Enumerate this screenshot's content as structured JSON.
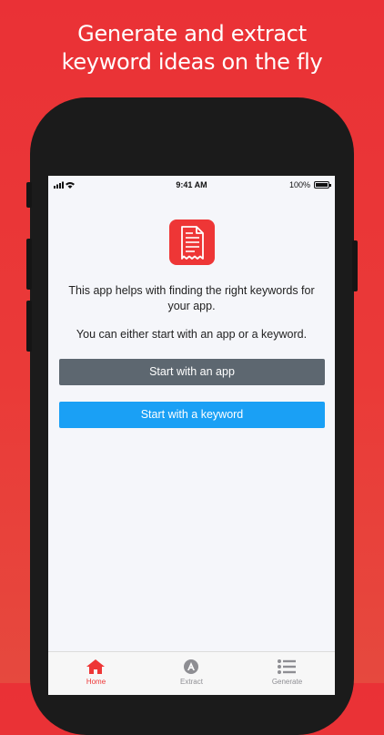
{
  "headline": {
    "line1": "Generate and extract",
    "line2": "keyword ideas on the fly"
  },
  "status_bar": {
    "time": "9:41 AM",
    "battery": "100%"
  },
  "intro": {
    "text1": "This app helps with finding the right keywords for your app.",
    "text2": "You can either start with an app or a keyword."
  },
  "buttons": {
    "start_app": "Start with an app",
    "start_keyword": "Start with a keyword"
  },
  "tabs": [
    {
      "label": "Home",
      "icon": "home-icon",
      "active": true
    },
    {
      "label": "Extract",
      "icon": "extract-icon",
      "active": false
    },
    {
      "label": "Generate",
      "icon": "list-icon",
      "active": false
    }
  ],
  "colors": {
    "background": "#ea3136",
    "accent": "#ee3636",
    "button_app": "#5d6770",
    "button_keyword": "#1aa0f5",
    "tab_active": "#ee3636",
    "tab_inactive": "#8e8e93"
  }
}
